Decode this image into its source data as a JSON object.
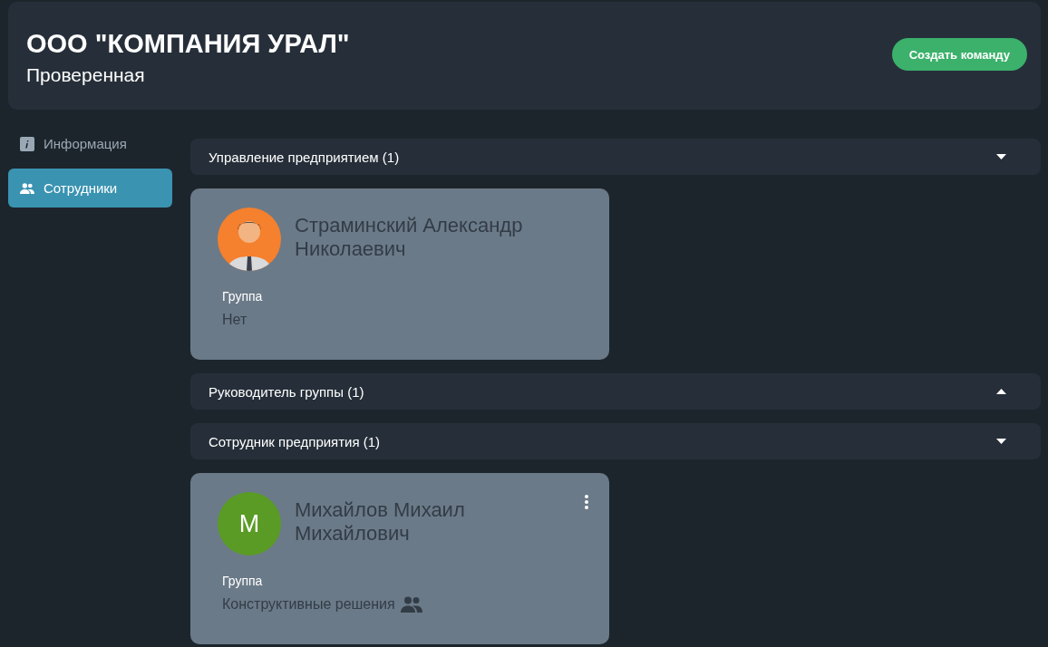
{
  "header": {
    "title": "ООО \"КОМПАНИЯ УРАЛ\"",
    "status": "Проверенная",
    "action_button": "Создать команду"
  },
  "sidebar": {
    "items": [
      {
        "label": "Информация",
        "selected": false
      },
      {
        "label": "Сотрудники",
        "selected": true
      }
    ]
  },
  "sections": [
    {
      "title": "Управление предприятием (1)",
      "expanded": true,
      "employees": [
        {
          "name": "Страминский Александр Николаевич",
          "avatar": {
            "kind": "illustration",
            "color": "#f5802d"
          },
          "has_menu": false,
          "group_label": "Группа",
          "group_value": "Нет",
          "group_icon": false
        }
      ]
    },
    {
      "title": "Руководитель группы (1)",
      "expanded": false
    },
    {
      "title": "Сотрудник предприятия (1)",
      "expanded": true,
      "employees": [
        {
          "name": "Михайлов Михаил Михайлович",
          "avatar": {
            "kind": "initial",
            "letter": "М",
            "color": "#5a9b25"
          },
          "has_menu": true,
          "group_label": "Группа",
          "group_value": "Конструктивные решения",
          "group_icon": true
        }
      ]
    }
  ]
}
